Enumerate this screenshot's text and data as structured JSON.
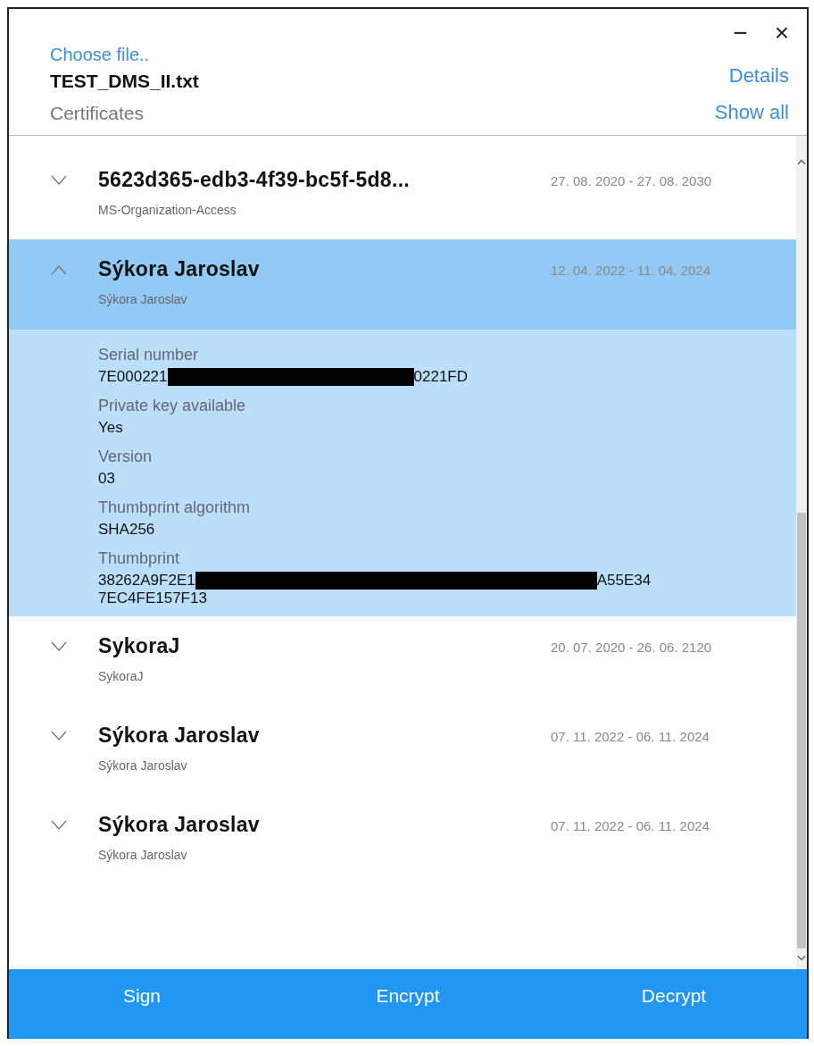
{
  "window": {
    "minimize": "−",
    "close": "×"
  },
  "header": {
    "choose_file": "Choose file..",
    "file_name": "TEST_DMS_II.txt",
    "section": "Certificates",
    "details_link": "Details",
    "show_all_link": "Show all"
  },
  "certificates": [
    {
      "title": "5623d365-edb3-4f39-bc5f-5d8...",
      "subject": "MS-Organization-Access",
      "validity": "27. 08. 2020 - 27. 08. 2030",
      "expanded": false
    },
    {
      "title": "Sýkora Jaroslav",
      "subject": "Sýkora Jaroslav",
      "validity": "12. 04. 2022 - 11. 04. 2024",
      "expanded": true,
      "details": [
        {
          "label": "Serial number",
          "lines": [
            [
              {
                "kind": "text",
                "text": "7E000221"
              },
              {
                "kind": "redacted"
              },
              {
                "kind": "text",
                "text": "0221FD"
              }
            ]
          ]
        },
        {
          "label": "Private key available",
          "lines": [
            [
              {
                "kind": "text",
                "text": "Yes"
              }
            ]
          ]
        },
        {
          "label": "Version",
          "lines": [
            [
              {
                "kind": "text",
                "text": "03"
              }
            ]
          ]
        },
        {
          "label": "Thumbprint algorithm",
          "lines": [
            [
              {
                "kind": "text",
                "text": "SHA256"
              }
            ]
          ]
        },
        {
          "label": "Thumbprint",
          "lines": [
            [
              {
                "kind": "text",
                "text": "38262A9F2E1"
              },
              {
                "kind": "redacted"
              },
              {
                "kind": "text",
                "text": "A55E34"
              }
            ],
            [
              {
                "kind": "text",
                "text": "7EC4FE157F13"
              }
            ]
          ]
        }
      ]
    },
    {
      "title": "SykoraJ",
      "subject": "SykoraJ",
      "validity": "20. 07. 2020 - 26. 06. 2120",
      "expanded": false
    },
    {
      "title": "Sýkora Jaroslav",
      "subject": "Sýkora Jaroslav",
      "validity": "07. 11. 2022 - 06. 11. 2024",
      "expanded": false
    },
    {
      "title": "Sýkora Jaroslav",
      "subject": "Sýkora Jaroslav",
      "validity": "07. 11. 2022 - 06. 11. 2024",
      "expanded": false
    }
  ],
  "actions": [
    "Sign",
    "Encrypt",
    "Decrypt"
  ]
}
